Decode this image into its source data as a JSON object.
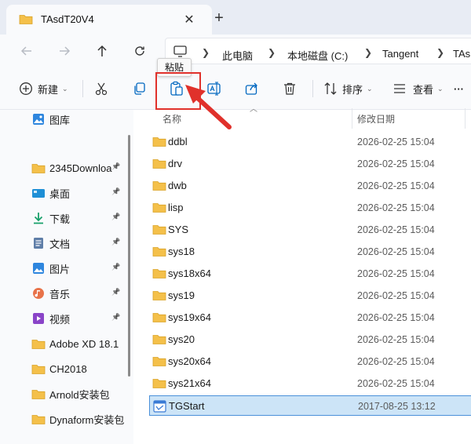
{
  "tab": {
    "title": "TAsdT20V4",
    "close": "✕",
    "new_tab": "+"
  },
  "breadcrumb": [
    "此电脑",
    "本地磁盘 (C:)",
    "Tangent",
    "TAs"
  ],
  "toolbar": {
    "new_label": "新建",
    "sort_label": "排序",
    "view_label": "查看",
    "more": "···",
    "tooltip": "粘贴"
  },
  "sidebar": {
    "top_item": "图库",
    "items": [
      {
        "label": "2345Downloa",
        "icon": "folder-icon",
        "pinned": true
      },
      {
        "label": "桌面",
        "icon": "desktop-icon",
        "pinned": true
      },
      {
        "label": "下载",
        "icon": "download-icon",
        "pinned": true
      },
      {
        "label": "文档",
        "icon": "document-icon",
        "pinned": true
      },
      {
        "label": "图片",
        "icon": "picture-icon",
        "pinned": true
      },
      {
        "label": "音乐",
        "icon": "music-icon",
        "pinned": true
      },
      {
        "label": "视频",
        "icon": "video-icon",
        "pinned": true
      },
      {
        "label": "Adobe XD 18.1",
        "icon": "folder-icon",
        "pinned": false
      },
      {
        "label": "CH2018",
        "icon": "folder-icon",
        "pinned": false
      },
      {
        "label": "Arnold安装包",
        "icon": "folder-icon",
        "pinned": false
      },
      {
        "label": "Dynaform安装包",
        "icon": "folder-icon",
        "pinned": false
      }
    ]
  },
  "columns": {
    "name": "名称",
    "modified": "修改日期"
  },
  "files": [
    {
      "name": "ddbl",
      "date": "2026-02-25 15:04"
    },
    {
      "name": "drv",
      "date": "2026-02-25 15:04"
    },
    {
      "name": "dwb",
      "date": "2026-02-25 15:04"
    },
    {
      "name": "lisp",
      "date": "2026-02-25 15:04"
    },
    {
      "name": "SYS",
      "date": "2026-02-25 15:04"
    },
    {
      "name": "sys18",
      "date": "2026-02-25 15:04"
    },
    {
      "name": "sys18x64",
      "date": "2026-02-25 15:04"
    },
    {
      "name": "sys19",
      "date": "2026-02-25 15:04"
    },
    {
      "name": "sys19x64",
      "date": "2026-02-25 15:04"
    },
    {
      "name": "sys20",
      "date": "2026-02-25 15:04"
    },
    {
      "name": "sys20x64",
      "date": "2026-02-25 15:04"
    },
    {
      "name": "sys21x64",
      "date": "2026-02-25 15:04"
    },
    {
      "name": "TGStart",
      "date": "2017-08-25 13:12",
      "selected": true,
      "type": "app"
    }
  ],
  "colors": {
    "accent": "#0067c0",
    "folder": "#f4c04a",
    "highlight": "#e0312b",
    "selection": "#cce4f7"
  }
}
